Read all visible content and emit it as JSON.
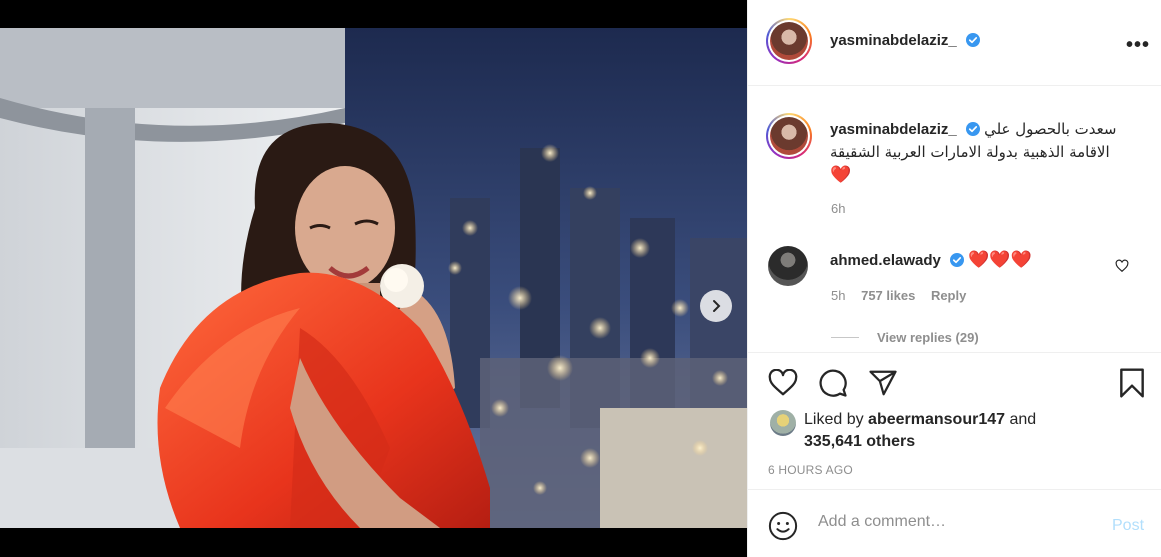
{
  "post": {
    "username": "yasminabdelaziz_",
    "more_label": "•••",
    "caption": "سعدت بالحصول علي الاقامة الذهبية بدولة الامارات العربية الشقيقة",
    "caption_emoji": "❤️",
    "caption_time": "6h",
    "media_dots_count": 3,
    "media_active_dot": 0
  },
  "comment": {
    "username": "ahmed.elawady",
    "text": "❤️❤️❤️",
    "time": "5h",
    "likes": "757 likes",
    "reply_label": "Reply",
    "view_replies": "View replies (29)"
  },
  "likes": {
    "prefix": "Liked by ",
    "user": "abeermansour147",
    "and": " and",
    "others": "335,641 others"
  },
  "timestamp": "6 HOURS AGO",
  "add_comment": {
    "placeholder": "Add a comment…",
    "post_label": "Post"
  },
  "colors": {
    "verified": "#3897f0",
    "link_blue": "#0095f6",
    "post_disabled": "#b2dffc",
    "muted": "#8e8e8e"
  }
}
